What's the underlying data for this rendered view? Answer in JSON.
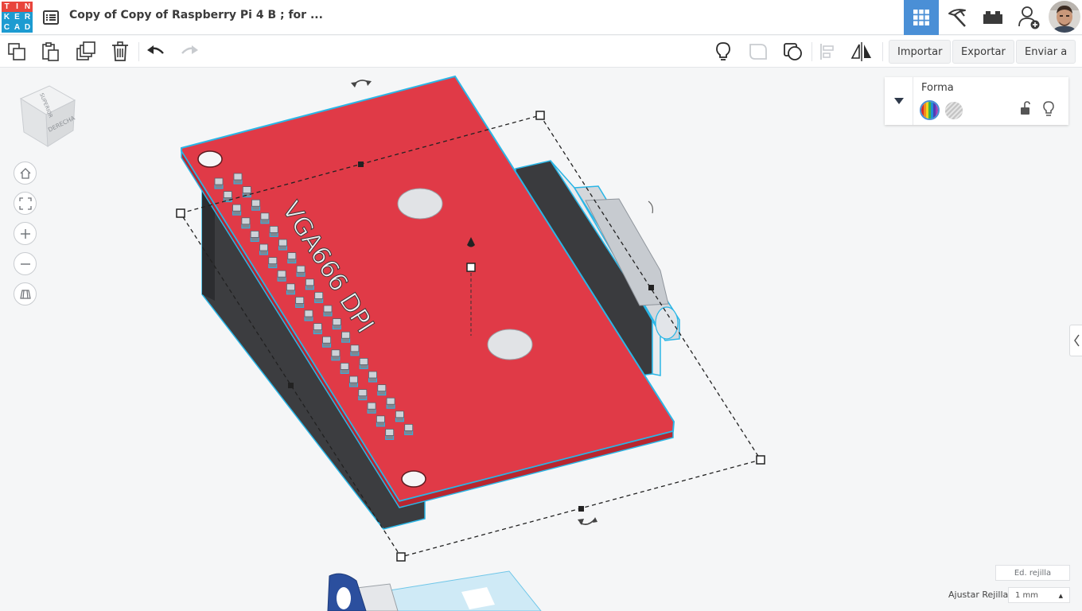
{
  "app": {
    "logo_letters": [
      "T",
      "I",
      "N",
      "K",
      "E",
      "R",
      "C",
      "A",
      "D"
    ],
    "logo_colors": [
      "#e8453c",
      "#e8453c",
      "#e8453c",
      "#1d9bd1",
      "#1d9bd1",
      "#1d9bd1",
      "#1d9bd1",
      "#1d9bd1",
      "#1d9bd1"
    ]
  },
  "header": {
    "title": "Copy of Copy of Raspberry Pi 4 B ; for ...",
    "active_view_color": "#4a8fd6"
  },
  "toolbar": {
    "import_label": "Importar",
    "export_label": "Exportar",
    "send_label": "Enviar a"
  },
  "view_cube": {
    "top_face": "SUPERIOR",
    "front_face": "DERECHA"
  },
  "inspector": {
    "title": "Forma"
  },
  "model": {
    "label": "VGA666 DPI",
    "board_color": "#e03a47",
    "outline_color": "#2ab6e6"
  },
  "grid": {
    "edit_label": "Ed. rejilla",
    "snap_label": "Ajustar Rejilla",
    "snap_value": "1 mm"
  }
}
